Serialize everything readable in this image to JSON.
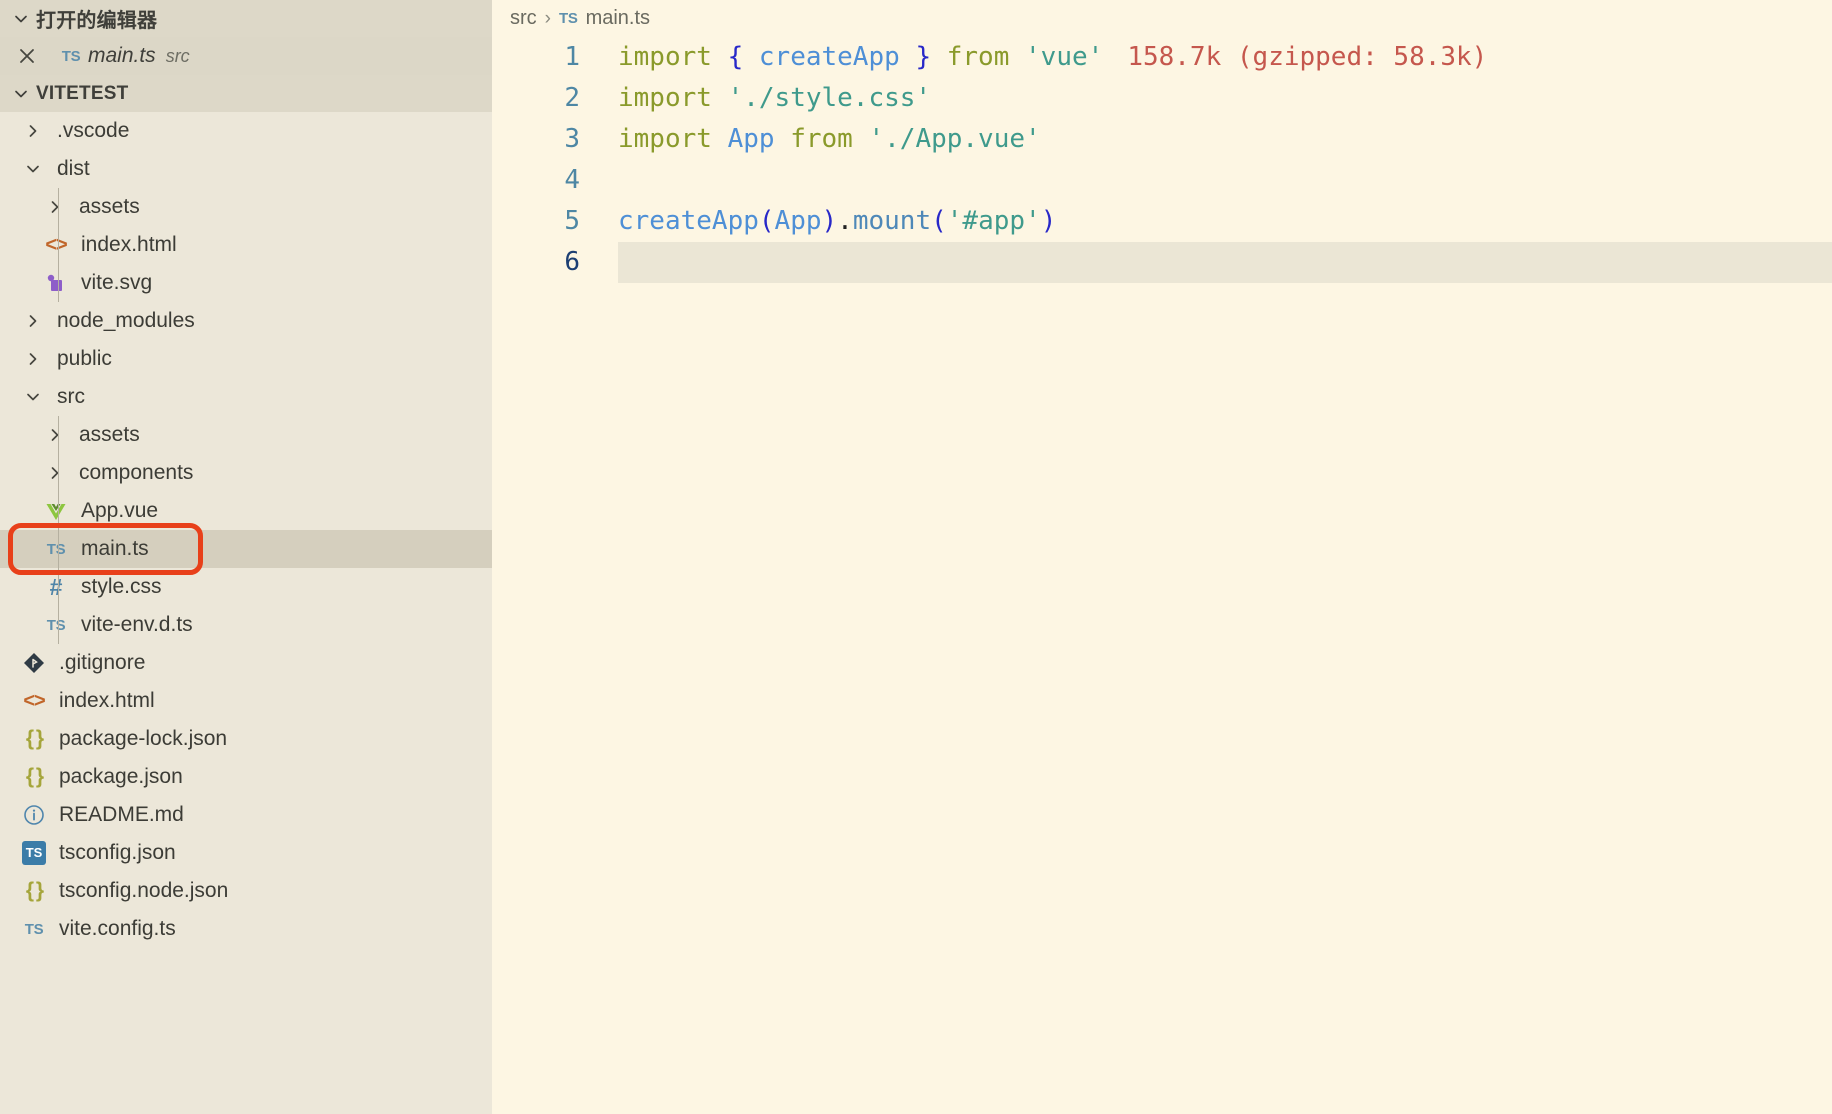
{
  "sidebar": {
    "open_editors": {
      "title": "打开的编辑器",
      "twisty": "chevron-down-icon",
      "items": [
        {
          "close": "close-icon",
          "icon": "typescript-icon",
          "icon_text": "TS",
          "name": "main.ts",
          "description": "src",
          "selected": true
        }
      ]
    },
    "explorer": {
      "title": "VITETEST",
      "twisty": "chevron-down-icon",
      "items": [
        {
          "label": ".vscode",
          "kind": "folder",
          "icon_text": "",
          "expanded": false,
          "depth": 1,
          "chevron": "chevron-right-icon"
        },
        {
          "label": "dist",
          "kind": "folder",
          "icon_text": "",
          "expanded": true,
          "depth": 1,
          "chevron": "chevron-down-icon"
        },
        {
          "label": "assets",
          "kind": "folder",
          "icon_text": "",
          "expanded": false,
          "depth": 2,
          "chevron": "chevron-right-icon"
        },
        {
          "label": "index.html",
          "kind": "html",
          "icon_text": "<>",
          "depth": 2
        },
        {
          "label": "vite.svg",
          "kind": "svg",
          "icon_text": "",
          "depth": 2
        },
        {
          "label": "node_modules",
          "kind": "folder",
          "icon_text": "",
          "expanded": false,
          "depth": 1,
          "chevron": "chevron-right-icon"
        },
        {
          "label": "public",
          "kind": "folder",
          "icon_text": "",
          "expanded": false,
          "depth": 1,
          "chevron": "chevron-right-icon"
        },
        {
          "label": "src",
          "kind": "folder",
          "icon_text": "",
          "expanded": true,
          "depth": 1,
          "chevron": "chevron-down-icon"
        },
        {
          "label": "assets",
          "kind": "folder",
          "icon_text": "",
          "expanded": false,
          "depth": 2,
          "chevron": "chevron-right-icon"
        },
        {
          "label": "components",
          "kind": "folder",
          "icon_text": "",
          "expanded": false,
          "depth": 2,
          "chevron": "chevron-right-icon"
        },
        {
          "label": "App.vue",
          "kind": "vue",
          "icon_text": "",
          "depth": 2
        },
        {
          "label": "main.ts",
          "kind": "ts",
          "icon_text": "TS",
          "depth": 2,
          "selected": true,
          "highlighted": true
        },
        {
          "label": "style.css",
          "kind": "css",
          "icon_text": "#",
          "depth": 2
        },
        {
          "label": "vite-env.d.ts",
          "kind": "ts",
          "icon_text": "TS",
          "depth": 2
        },
        {
          "label": ".gitignore",
          "kind": "git",
          "icon_text": "",
          "depth": 1
        },
        {
          "label": "index.html",
          "kind": "html",
          "icon_text": "<>",
          "depth": 1
        },
        {
          "label": "package-lock.json",
          "kind": "json",
          "icon_text": "{ }",
          "depth": 1
        },
        {
          "label": "package.json",
          "kind": "json",
          "icon_text": "{ }",
          "depth": 1
        },
        {
          "label": "README.md",
          "kind": "md",
          "icon_text": "i",
          "depth": 1
        },
        {
          "label": "tsconfig.json",
          "kind": "tsconfig",
          "icon_text": "TS",
          "depth": 1
        },
        {
          "label": "tsconfig.node.json",
          "kind": "json",
          "icon_text": "{ }",
          "depth": 1
        },
        {
          "label": "vite.config.ts",
          "kind": "ts",
          "icon_text": "TS",
          "depth": 1
        }
      ]
    },
    "annotation": {
      "shape": "rounded-rectangle",
      "color": "#e8401a",
      "targets": "main.ts"
    }
  },
  "editor": {
    "breadcrumb": {
      "folder": "src",
      "separator": "›",
      "file_icon_text": "TS",
      "file": "main.ts"
    },
    "lines": [
      {
        "no": "1",
        "active": false
      },
      {
        "no": "2",
        "active": false
      },
      {
        "no": "3",
        "active": false
      },
      {
        "no": "4",
        "active": false
      },
      {
        "no": "5",
        "active": false
      },
      {
        "no": "6",
        "active": true
      }
    ],
    "code": {
      "l1": {
        "kw1": "import",
        "brace_open": "{",
        "ident": "createApp",
        "brace_close": "}",
        "kw2": "from",
        "str": "'vue'",
        "hint": "158.7k (gzipped: 58.3k)"
      },
      "l2": {
        "kw1": "import",
        "str": "'./style.css'"
      },
      "l3": {
        "kw1": "import",
        "ident": "App",
        "kw2": "from",
        "str": "'./App.vue'"
      },
      "l4": {
        "text": ""
      },
      "l5": {
        "fn": "createApp",
        "paren_open": "(",
        "arg": "App",
        "paren_close": ")",
        "dot": ".",
        "method": "mount",
        "paren_open2": "(",
        "str": "'#app'",
        "paren_close2": ")"
      },
      "l6": {
        "text": ""
      }
    }
  },
  "colors": {
    "sidebar_bg": "#ece7d9",
    "section_bg": "#ddd8c8",
    "selected_row": "#d5cfbe",
    "editor_bg": "#fdf6e3",
    "active_line": "#ebe6d5",
    "annotation": "#e8401a",
    "keyword": "#8a9a2b",
    "string": "#3f9a8c",
    "identifier": "#4e8fd6",
    "punct": "#2828c8",
    "hint": "#c5574d",
    "lineno": "#4e87a4"
  }
}
